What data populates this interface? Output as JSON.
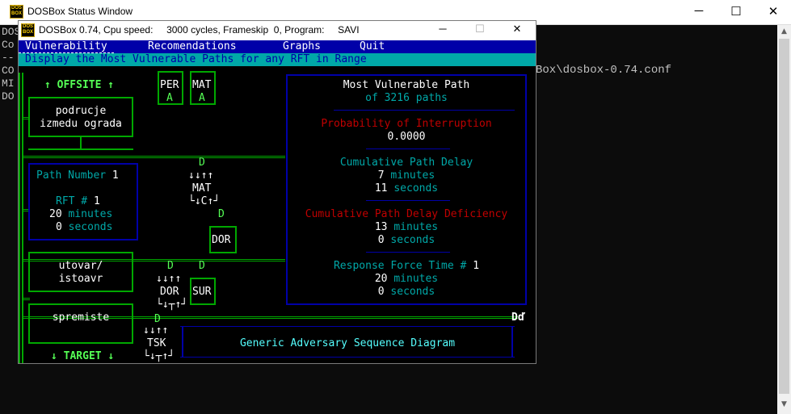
{
  "console": {
    "title": "DOSBox Status Window",
    "lines": [
      "DOS",
      "Co",
      "--",
      "CO",
      "MI",
      "DO"
    ],
    "config_text": "Box\\dosbox-0.74.conf",
    "controls": {
      "minimize": "─",
      "maximize": "☐",
      "close": "✕"
    }
  },
  "dosbox": {
    "logo_top": "DOS",
    "logo_bottom": "BOX",
    "title": "DOSBox 0.74, Cpu speed:     3000 cycles, Frameskip  0, Program:     SAVI",
    "controls": {
      "minimize": "─",
      "maximize": "☐",
      "close": "✕"
    }
  },
  "app": {
    "menu": [
      "Vulnerability",
      "Recomendations",
      "Graphs",
      "Quit"
    ],
    "status": "Display the Most Vulnerable Paths for any RFT in Range",
    "offsite": "↑ OFFSITE ↑",
    "target": "↓ TARGET ↓",
    "areas": [
      "podrucje\nizmedu ograda",
      "utovar/\nistoavr",
      "spremiste"
    ],
    "path_info": {
      "path_label": "Path Number",
      "path_number": "1",
      "rft_label": "RFT #",
      "rft_number": "1",
      "minutes_value": "20",
      "minutes_unit": "minutes",
      "seconds_value": "0",
      "seconds_unit": "seconds"
    },
    "elements": {
      "per": "PER",
      "mat_top": "MAT",
      "mat_mid": "MAT",
      "dor_mid": "DOR",
      "dor_low": "DOR",
      "sur": "SUR",
      "tsk": "TSK",
      "a": "A",
      "d": "D",
      "c": "C"
    },
    "summary": {
      "title": "Most Vulnerable Path",
      "paths": "of 3216 paths",
      "prob_label": "Probability of Interruption",
      "prob_value": "0.0000",
      "delay_label": "Cumulative Path Delay",
      "delay_minutes": "7",
      "delay_seconds": "11",
      "deficiency_label": "Cumulative Path Delay Deficiency",
      "deficiency_minutes": "13",
      "deficiency_seconds": "0",
      "rft_label": "Response Force Time #",
      "rft_number": "1",
      "rft_minutes": "20",
      "rft_seconds": "0",
      "minutes_unit": "minutes",
      "seconds_unit": "seconds"
    },
    "diagram_label": "Generic Adversary Sequence Diagram",
    "corner_label": "Dď"
  },
  "colors": {
    "menu_bg": "#0000a8",
    "status_bg": "#00a8a8",
    "green": "#00a800",
    "light_green": "#55ff55",
    "cyan": "#55ffff",
    "red": "#ff2020"
  }
}
